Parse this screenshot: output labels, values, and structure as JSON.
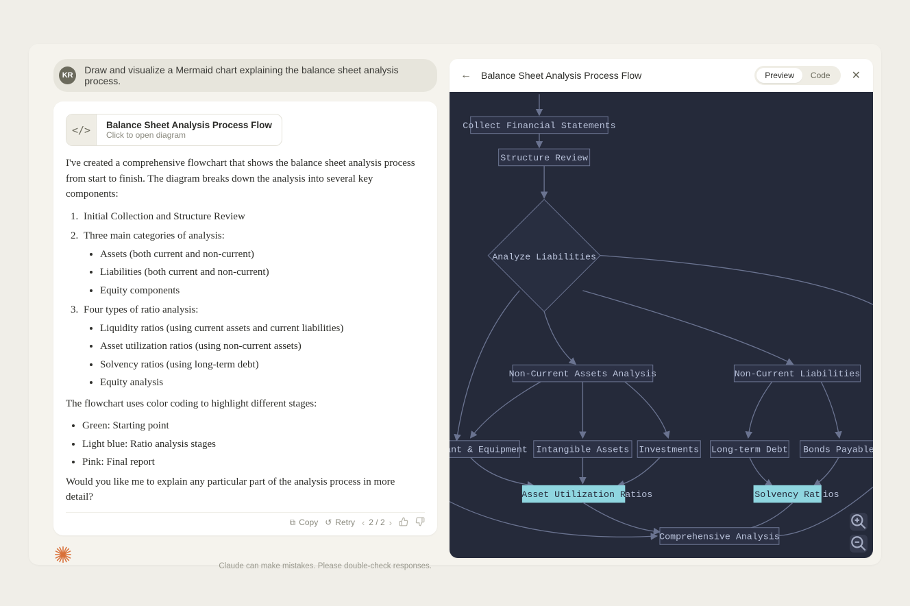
{
  "user": {
    "initials": "KR",
    "prompt": "Draw and visualize a Mermaid chart explaining the balance sheet analysis process."
  },
  "artifact": {
    "icon_label": "</>",
    "title": "Balance Sheet Analysis Process Flow",
    "subtitle": "Click to open diagram"
  },
  "assistant": {
    "intro": "I've created a comprehensive flowchart that shows the balance sheet analysis process from start to finish. The diagram breaks down the analysis into several key components:",
    "ol1": "Initial Collection and Structure Review",
    "ol2": "Three main categories of analysis:",
    "ol2_items": {
      "a": "Assets (both current and non-current)",
      "b": "Liabilities (both current and non-current)",
      "c": "Equity components"
    },
    "ol3": "Four types of ratio analysis:",
    "ol3_items": {
      "a": "Liquidity ratios (using current assets and current liabilities)",
      "b": "Asset utilization ratios (using non-current assets)",
      "c": "Solvency ratios (using long-term debt)",
      "d": "Equity analysis"
    },
    "color_intro": "The flowchart uses color coding to highlight different stages:",
    "colors": {
      "a": "Green: Starting point",
      "b": "Light blue: Ratio analysis stages",
      "c": "Pink: Final report"
    },
    "outro": "Would you like me to explain any particular part of the analysis process in more detail?"
  },
  "actions": {
    "copy": "Copy",
    "retry": "Retry",
    "pager": "2 / 2"
  },
  "disclaimer": "Claude can make mistakes. Please double-check responses.",
  "panel": {
    "title": "Balance Sheet Analysis Process Flow",
    "preview": "Preview",
    "code": "Code"
  },
  "diagram": {
    "n1": "Collect Financial Statements",
    "n2": "Structure Review",
    "n3": "Analyze Liabilities",
    "n4": "Non-Current Assets Analysis",
    "n5": "Non-Current Liabilities",
    "n6": "Plant & Equipment",
    "n7": "Intangible Assets",
    "n8": "Investments",
    "n9": "Long-term Debt",
    "n10": "Bonds Payable",
    "n11a": "Asset Utilization R",
    "n11b": "atios",
    "n12a": "Solvency Rat",
    "n12b": "ios",
    "n13": "Comprehensive Analysis"
  }
}
